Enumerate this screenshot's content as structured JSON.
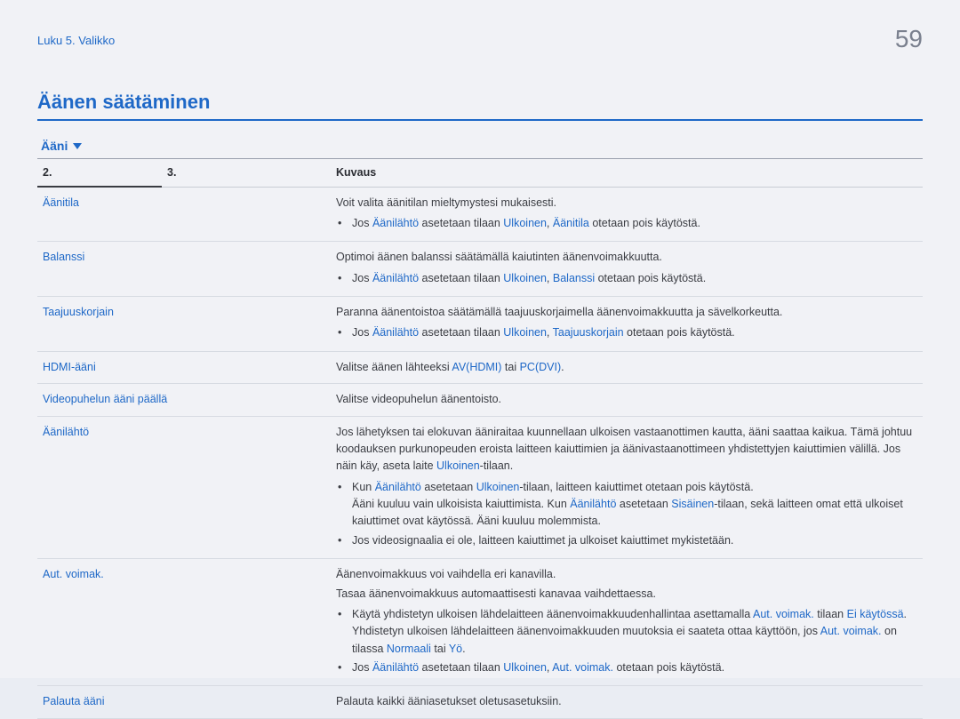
{
  "header": {
    "chapter": "Luku 5. Valikko",
    "page_number": "59"
  },
  "title": "Äänen säätäminen",
  "subsection": "Ääni",
  "table": {
    "columns": {
      "c1": "2.",
      "c2": "3.",
      "c3": "Kuvaus"
    }
  },
  "terms": {
    "aanilahto": "Äänilähtö",
    "ulkoinen": "Ulkoinen",
    "sisainen": "Sisäinen",
    "aanitila": "Äänitila",
    "balanssi": "Balanssi",
    "taajuuskorjain": "Taajuuskorjain",
    "avhdmi": "AV(HDMI)",
    "pcdvi": "PC(DVI)",
    "aut_voimak": "Aut. voimak.",
    "ei_kaytossa": "Ei käytössä",
    "normaali": "Normaali",
    "yo": "Yö"
  },
  "rows": {
    "aanitila": {
      "label": "Äänitila",
      "desc": "Voit valita äänitilan mieltymystesi mukaisesti.",
      "note_pre": "Jos ",
      "note_mid1": " asetetaan tilaan ",
      "note_mid2": ", ",
      "note_end": " otetaan pois käytöstä."
    },
    "balanssi": {
      "label": "Balanssi",
      "desc": "Optimoi äänen balanssi säätämällä kaiutinten äänenvoimakkuutta.",
      "note_pre": "Jos ",
      "note_mid1": " asetetaan tilaan ",
      "note_mid2": ", ",
      "note_end": " otetaan pois käytöstä."
    },
    "taajuus": {
      "label": "Taajuuskorjain",
      "desc": "Paranna äänentoistoa säätämällä taajuuskorjaimella äänenvoimakkuutta ja sävelkorkeutta.",
      "note_pre": "Jos ",
      "note_mid1": " asetetaan tilaan ",
      "note_mid2": ", ",
      "note_end": " otetaan pois käytöstä."
    },
    "hdmi": {
      "label": "HDMI-ääni",
      "desc_pre": "Valitse äänen lähteeksi ",
      "desc_or": " tai ",
      "desc_end": "."
    },
    "videopuhelu": {
      "label": "Videopuhelun ääni päällä",
      "desc": "Valitse videopuhelun äänentoisto."
    },
    "aanilahto": {
      "label": "Äänilähtö",
      "p1": "Jos lähetyksen tai elokuvan ääniraitaa kuunnellaan ulkoisen vastaanottimen kautta, ääni saattaa kaikua. Tämä johtuu koodauksen purkunopeuden eroista laitteen kaiuttimien ja äänivastaanottimeen yhdistettyjen kaiuttimien välillä. Jos näin käy, aseta laite ",
      "p1_end": "-tilaan.",
      "b1_pre": "Kun ",
      "b1_mid": " asetetaan ",
      "b1_end": "-tilaan, laitteen kaiuttimet otetaan pois käytöstä.",
      "b1_line2_pre": "Ääni kuuluu vain ulkoisista kaiuttimista. Kun ",
      "b1_line2_mid": " asetetaan ",
      "b1_line2_end": "-tilaan, sekä laitteen omat että ulkoiset kaiuttimet ovat käytössä. Ääni kuuluu molemmista.",
      "b2": "Jos videosignaalia ei ole, laitteen kaiuttimet ja ulkoiset kaiuttimet mykistetään."
    },
    "autvoimak": {
      "label": "Aut. voimak.",
      "p1": "Äänenvoimakkuus voi vaihdella eri kanavilla.",
      "p2": "Tasaa äänenvoimakkuus automaattisesti kanavaa vaihdettaessa.",
      "b1_pre": "Käytä yhdistetyn ulkoisen lähdelaitteen äänenvoimakkuudenhallintaa asettamalla ",
      "b1_mid": " tilaan ",
      "b1_end": ". Yhdistetyn ulkoisen lähdelaitteen äänenvoimakkuuden muutoksia ei saateta ottaa käyttöön, jos ",
      "b1_mid2": " on tilassa ",
      "b1_or": " tai ",
      "b1_fin": ".",
      "b2_pre": "Jos ",
      "b2_mid1": " asetetaan tilaan ",
      "b2_mid2": ", ",
      "b2_end": " otetaan pois käytöstä."
    },
    "palauta": {
      "label": "Palauta ääni",
      "desc": "Palauta kaikki ääniasetukset oletusasetuksiin."
    }
  }
}
